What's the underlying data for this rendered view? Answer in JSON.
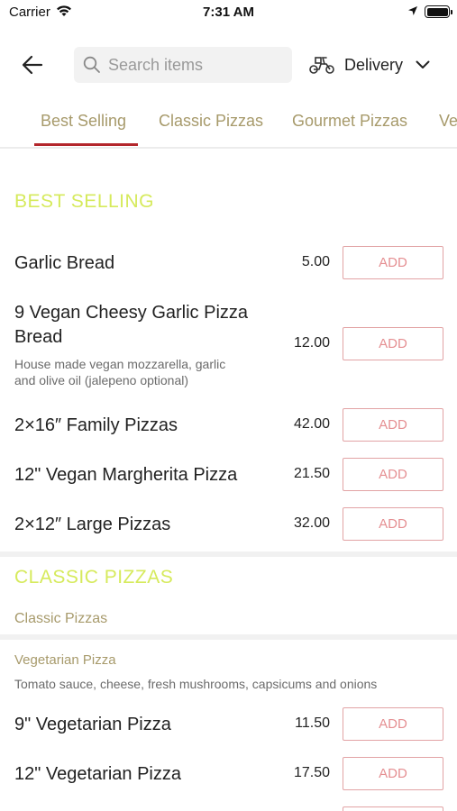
{
  "status_bar": {
    "carrier": "Carrier",
    "time": "7:31 AM"
  },
  "header": {
    "search_placeholder": "Search items",
    "delivery_label": "Delivery"
  },
  "tabs": [
    {
      "label": "Best Selling",
      "active": true
    },
    {
      "label": "Classic Pizzas",
      "active": false
    },
    {
      "label": "Gourmet Pizzas",
      "active": false
    },
    {
      "label": "Ve",
      "active": false
    }
  ],
  "best_selling": {
    "title": "BEST SELLING",
    "items": [
      {
        "name": "Garlic Bread",
        "price": "5.00",
        "add_label": "ADD"
      },
      {
        "name_line1": "9 Vegan Cheesy Garlic Pizza",
        "name_line2": "Bread",
        "desc_line1": "House made vegan mozzarella, garlic",
        "desc_line2": "and olive oil (jalepeno optional)",
        "price": "12.00",
        "add_label": "ADD"
      },
      {
        "name": "2×16″ Family Pizzas",
        "price": "42.00",
        "add_label": "ADD"
      },
      {
        "name": "12\" Vegan Margherita Pizza",
        "price": "21.50",
        "add_label": "ADD"
      },
      {
        "name": "2×12″ Large Pizzas",
        "price": "32.00",
        "add_label": "ADD"
      }
    ]
  },
  "classic_pizzas": {
    "title": "CLASSIC PIZZAS",
    "subcategory": "Classic Pizzas",
    "group_title": "Vegetarian Pizza",
    "group_desc": "Tomato sauce, cheese, fresh mushrooms, capsicums and onions",
    "items": [
      {
        "name": "9\" Vegetarian Pizza",
        "price": "11.50",
        "add_label": "ADD"
      },
      {
        "name": "12\" Vegetarian Pizza",
        "price": "17.50",
        "add_label": "ADD"
      }
    ]
  },
  "colors": {
    "accent_red": "#b3262b",
    "section_title": "#d6ea5c",
    "tab_text": "#a79a6b",
    "add_border": "#e2a3a5"
  },
  "icons": [
    "wifi-icon",
    "location-arrow-icon",
    "battery-icon",
    "back-arrow-icon",
    "search-icon",
    "scooter-icon",
    "chevron-down-icon"
  ]
}
